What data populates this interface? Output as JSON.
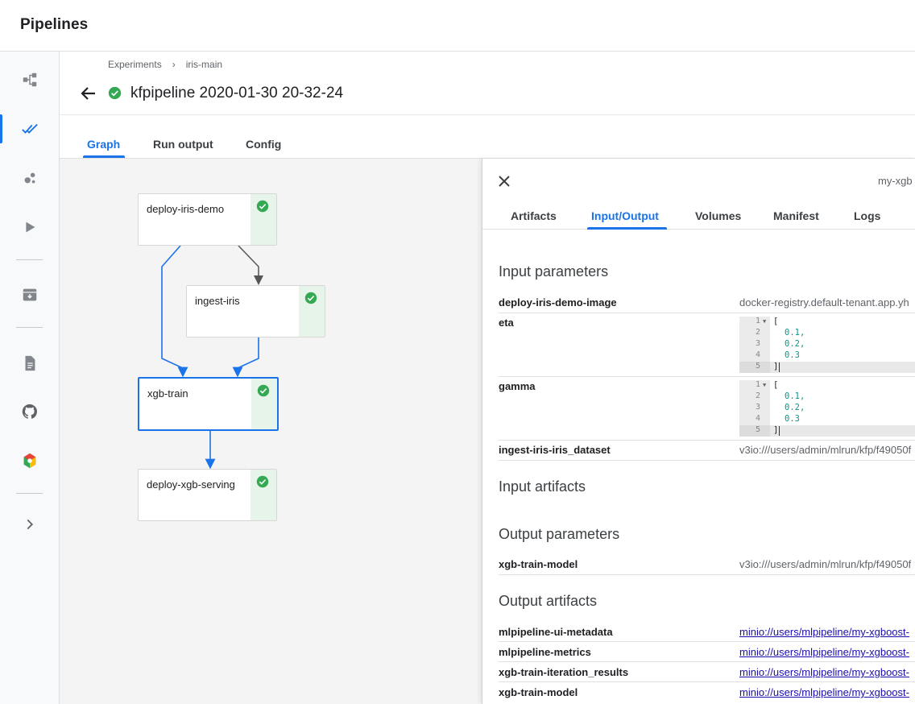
{
  "app": {
    "title": "Pipelines"
  },
  "sidebar": {
    "items": [
      {
        "name": "pipelines",
        "icon": "pipelines-icon"
      },
      {
        "name": "experiments",
        "icon": "experiments-icon",
        "active": true
      },
      {
        "name": "artifacts",
        "icon": "artifacts-icon"
      },
      {
        "name": "executions",
        "icon": "executions-icon"
      },
      {
        "name": "archive",
        "icon": "archive-icon"
      },
      {
        "name": "documentation",
        "icon": "documentation-icon"
      },
      {
        "name": "github",
        "icon": "github-icon"
      },
      {
        "name": "ai-hub",
        "icon": "ai-hub-icon"
      },
      {
        "name": "expand",
        "icon": "chevron-right-icon"
      }
    ]
  },
  "breadcrumb": {
    "experiments": "Experiments",
    "separator": "›",
    "experiment": "iris-main"
  },
  "run": {
    "title": "kfpipeline 2020-01-30 20-32-24",
    "status": "succeeded"
  },
  "tabs": [
    {
      "label": "Graph",
      "active": true
    },
    {
      "label": "Run output"
    },
    {
      "label": "Config"
    }
  ],
  "graph": {
    "nodes": [
      {
        "id": "deploy-iris-demo",
        "label": "deploy-iris-demo",
        "status": "succeeded"
      },
      {
        "id": "ingest-iris",
        "label": "ingest-iris",
        "status": "succeeded"
      },
      {
        "id": "xgb-train",
        "label": "xgb-train",
        "status": "succeeded",
        "selected": true
      },
      {
        "id": "deploy-xgb-serving",
        "label": "deploy-xgb-serving",
        "status": "succeeded"
      }
    ],
    "edges": [
      {
        "from": "deploy-iris-demo",
        "to": "ingest-iris"
      },
      {
        "from": "deploy-iris-demo",
        "to": "xgb-train"
      },
      {
        "from": "ingest-iris",
        "to": "xgb-train"
      },
      {
        "from": "xgb-train",
        "to": "deploy-xgb-serving"
      }
    ]
  },
  "panel": {
    "pod_name": "my-xgb",
    "tabs": [
      {
        "label": "Artifacts"
      },
      {
        "label": "Input/Output",
        "active": true
      },
      {
        "label": "Volumes"
      },
      {
        "label": "Manifest"
      },
      {
        "label": "Logs"
      }
    ],
    "input_parameters_title": "Input parameters",
    "input_parameters": [
      {
        "key": "deploy-iris-demo-image",
        "value": "docker-registry.default-tenant.app.yh"
      },
      {
        "key": "eta",
        "code": {
          "lines": [
            "[",
            "0.1,",
            "0.2,",
            "0.3",
            "]"
          ]
        }
      },
      {
        "key": "gamma",
        "code": {
          "lines": [
            "[",
            "0.1,",
            "0.2,",
            "0.3",
            "]"
          ]
        }
      },
      {
        "key": "ingest-iris-iris_dataset",
        "value": "v3io:///users/admin/mlrun/kfp/f49050f"
      }
    ],
    "input_artifacts_title": "Input artifacts",
    "output_parameters_title": "Output parameters",
    "output_parameters": [
      {
        "key": "xgb-train-model",
        "value": "v3io:///users/admin/mlrun/kfp/f49050f"
      }
    ],
    "output_artifacts_title": "Output artifacts",
    "output_artifacts": [
      {
        "key": "mlpipeline-ui-metadata",
        "link": "minio://users/mlpipeline/my-xgboost-"
      },
      {
        "key": "mlpipeline-metrics",
        "link": "minio://users/mlpipeline/my-xgboost-"
      },
      {
        "key": "xgb-train-iteration_results",
        "link": "minio://users/mlpipeline/my-xgboost-"
      },
      {
        "key": "xgb-train-model",
        "link": "minio://users/mlpipeline/my-xgboost-"
      }
    ]
  }
}
